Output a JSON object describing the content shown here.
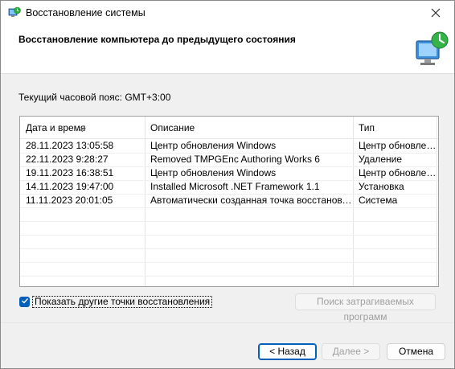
{
  "window": {
    "title": "Восстановление системы",
    "icons": {
      "app": "system-restore-icon",
      "close": "close-icon",
      "header": "restore-computer-icon",
      "sort": "sort-desc-icon",
      "check": "checkmark-icon"
    }
  },
  "header": {
    "title": "Восстановление компьютера до предыдущего состояния"
  },
  "timezone": {
    "text": "Текущий часовой пояс: GMT+3:00"
  },
  "table": {
    "columns": [
      "Дата и время",
      "Описание",
      "Тип"
    ],
    "rows": [
      [
        "28.11.2023 13:05:58",
        "Центр обновления Windows",
        "Центр обновления Windows"
      ],
      [
        "22.11.2023 9:28:27",
        "Removed TMPGEnc Authoring Works 6",
        "Удаление"
      ],
      [
        "19.11.2023 16:38:51",
        "Центр обновления Windows",
        "Центр обновления Windows"
      ],
      [
        "14.11.2023 19:47:00",
        "Installed Microsoft .NET Framework 1.1",
        "Установка"
      ],
      [
        "11.11.2023 20:01:05",
        "Автоматически созданная точка восстановления",
        "Система"
      ]
    ]
  },
  "show_more": {
    "label": "Показать другие точки восстановления",
    "checked": true
  },
  "buttons": {
    "scan": "Поиск затрагиваемых программ",
    "back": "< Назад",
    "next": "Далее >",
    "cancel": "Отмена"
  },
  "colors": {
    "accent": "#005fb8",
    "disabled_text": "#a0a0a0"
  }
}
